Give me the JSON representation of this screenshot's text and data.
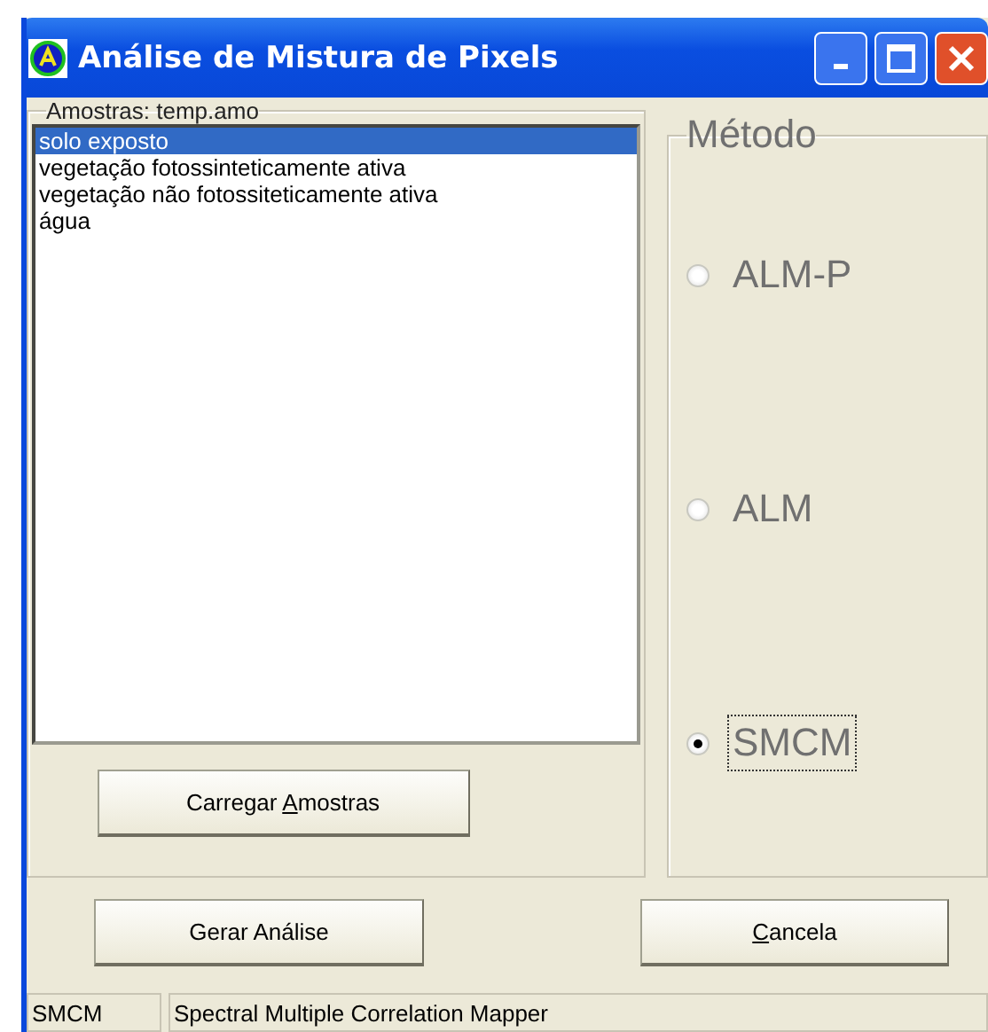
{
  "window": {
    "title": "Análise de Mistura de Pixels"
  },
  "samples": {
    "legend": "Amostras: temp.amo",
    "items": [
      {
        "label": "solo exposto",
        "selected": true
      },
      {
        "label": "vegetação fotossinteticamente ativa",
        "selected": false
      },
      {
        "label": "vegetação não fotossiteticamente ativa",
        "selected": false
      },
      {
        "label": "água",
        "selected": false
      }
    ],
    "load_button": {
      "before": "Carregar ",
      "mnemonic": "A",
      "after": "mostras"
    }
  },
  "method": {
    "legend": "Método",
    "options": [
      {
        "label": "ALM-P",
        "selected": false
      },
      {
        "label": "ALM",
        "selected": false
      },
      {
        "label": "SMCM",
        "selected": true
      }
    ]
  },
  "buttons": [
    {
      "before": "Gerar Análise"
    },
    {
      "mnemonic": "C",
      "after": "ancela"
    }
  ],
  "status_bar": [
    "SMCM",
    "Spectral Multiple Correlation Mapper"
  ]
}
